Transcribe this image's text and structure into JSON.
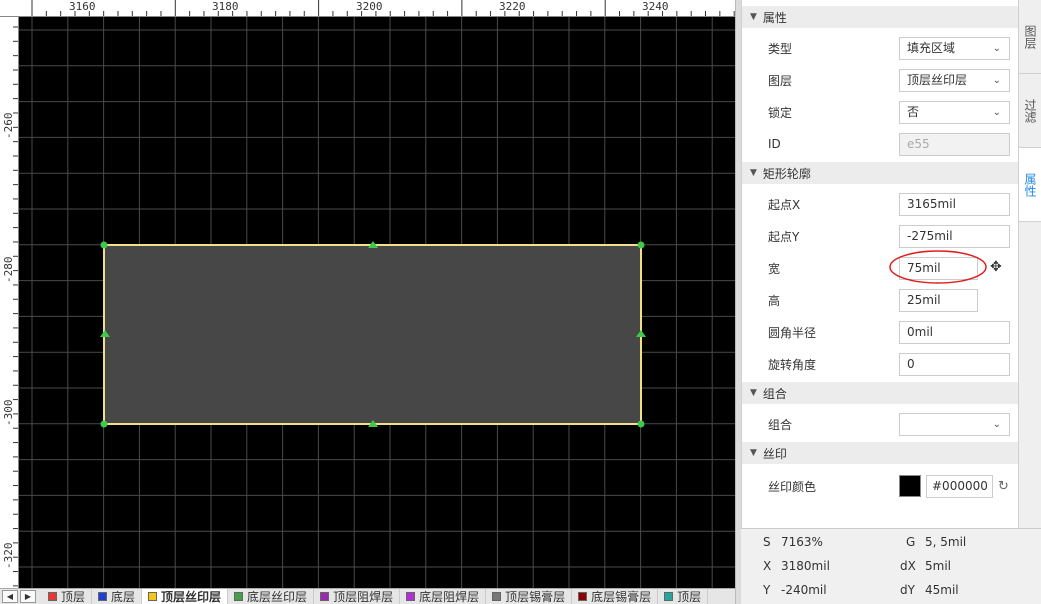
{
  "ruler": {
    "top_labels": [
      "3160",
      "3180",
      "3200",
      "3220",
      "3240"
    ],
    "left_labels": [
      "-260",
      "-280",
      "-300",
      "-320"
    ]
  },
  "layers": [
    {
      "name": "顶层",
      "color": "#e53935"
    },
    {
      "name": "底层",
      "color": "#1e3fd1"
    },
    {
      "name": "顶层丝印层",
      "color": "#f5c518",
      "active": true
    },
    {
      "name": "底层丝印层",
      "color": "#43a047"
    },
    {
      "name": "顶层阻焊层",
      "color": "#9c27b0"
    },
    {
      "name": "底层阻焊层",
      "color": "#b02fd6"
    },
    {
      "name": "顶层锡膏层",
      "color": "#777777"
    },
    {
      "name": "底层锡膏层",
      "color": "#8b0000"
    },
    {
      "name": "顶层",
      "color": "#26a69a"
    }
  ],
  "props": {
    "section_attr": "属性",
    "type_label": "类型",
    "type_value": "填充区域",
    "layer_label": "图层",
    "layer_value": "顶层丝印层",
    "lock_label": "锁定",
    "lock_value": "否",
    "id_label": "ID",
    "id_value": "e55",
    "section_rect": "矩形轮廓",
    "startx_label": "起点X",
    "startx_value": "3165mil",
    "starty_label": "起点Y",
    "starty_value": "-275mil",
    "width_label": "宽",
    "width_value": "75mil",
    "height_label": "高",
    "height_value": "25mil",
    "radius_label": "圆角半径",
    "radius_value": "0mil",
    "rotate_label": "旋转角度",
    "rotate_value": "0",
    "section_group": "组合",
    "group_label": "组合",
    "group_value": "",
    "section_silk": "丝印",
    "silk_color_label": "丝印颜色",
    "silk_color_value": "#000000"
  },
  "side_tabs": [
    {
      "label": "图层",
      "active": false
    },
    {
      "label": "过滤",
      "active": false
    },
    {
      "label": "属性",
      "active": true
    }
  ],
  "status": {
    "s_label": "S",
    "s_value": "7163%",
    "g_label": "G",
    "g_value": "5, 5mil",
    "x_label": "X",
    "x_value": "3180mil",
    "dx_label": "dX",
    "dx_value": "5mil",
    "y_label": "Y",
    "y_value": "-240mil",
    "dy_label": "dY",
    "dy_value": "45mil"
  },
  "colors": {
    "outline": "#f3df8a",
    "fill": "#474747",
    "handle": "#3ec94a",
    "annotation": "#e02020"
  }
}
